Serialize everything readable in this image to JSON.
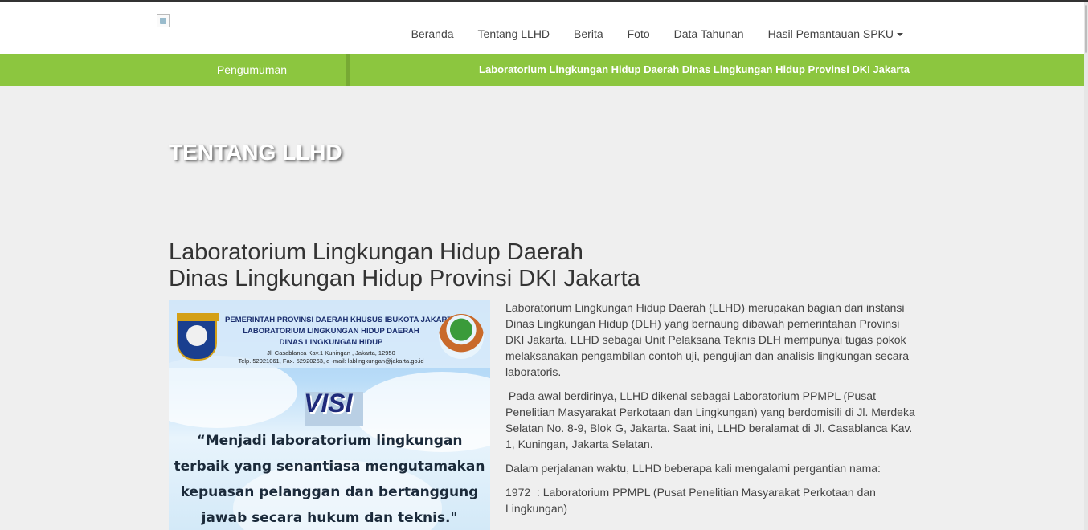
{
  "header": {
    "logo_alt": "",
    "nav": [
      {
        "label": "Beranda"
      },
      {
        "label": "Tentang LLHD"
      },
      {
        "label": "Berita"
      },
      {
        "label": "Foto"
      },
      {
        "label": "Data Tahunan"
      },
      {
        "label": "Hasil Pemantauan SPKU"
      }
    ]
  },
  "ticker": {
    "label": "Pengumuman",
    "text": "Laboratorium Lingkungan Hidup Daerah Dinas Lingkungan Hidup Provinsi DKI Jakarta"
  },
  "page": {
    "title": "TENTANG LLHD",
    "heading_line1": "Laboratorium Lingkungan Hidup Daerah",
    "heading_line2": "Dinas Lingkungan Hidup Provinsi DKI Jakarta"
  },
  "visi_image": {
    "header_lines": [
      "PEMERINTAH PROVINSI DAERAH KHUSUS IBUKOTA JAKARTA",
      "LABORATORIUM LINGKUNGAN HIDUP DAERAH",
      "DINAS LINGKUNGAN HIDUP",
      "Jl. Casablanca Kav.1  Kuningan , Jakarta, 12950",
      "Telp. 52921061, Fax. 52920263, e -mail: lablingkungan@jakarta.go.id"
    ],
    "emblem_text": "JAYA RAYA",
    "title": "VISI",
    "quote_lines": [
      "“Menjadi laboratorium lingkungan",
      "terbaik yang senantiasa mengutamakan",
      "kepuasan pelanggan dan bertanggung",
      "jawab secara hukum dan teknis.\""
    ]
  },
  "content": {
    "paragraphs": [
      "Laboratorium Lingkungan Hidup Daerah (LLHD) merupakan bagian dari instansi Dinas Lingkungan Hidup (DLH) yang bernaung dibawah pemerintahan Provinsi DKI Jakarta. LLHD sebagai Unit Pelaksana Teknis DLH mempunyai tugas pokok melaksanakan pengambilan contoh uji, pengujian dan analisis lingkungan secara laboratoris.",
      " Pada awal berdirinya, LLHD dikenal sebagai Laboratorium PPMPL (Pusat Penelitian Masyarakat Perkotaan dan Lingkungan) yang berdomisili di Jl. Merdeka Selatan No. 8-9, Blok G, Jakarta. Saat ini, LLHD beralamat di Jl. Casablanca Kav. 1, Kuningan, Jakarta Selatan.",
      "Dalam perjalanan waktu, LLHD beberapa kali mengalami pergantian nama:",
      "1972  : Laboratorium PPMPL (Pusat Penelitian Masyarakat Perkotaan dan Lingkungan)"
    ]
  },
  "colors": {
    "accent_green": "#8cc63f",
    "background": "#efefef"
  }
}
